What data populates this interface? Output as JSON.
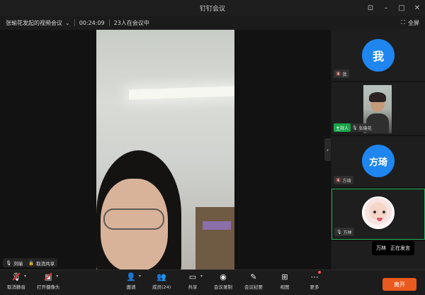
{
  "window": {
    "title": "钉钉会议"
  },
  "info": {
    "meeting_name": "张瑜花发起的视频会议",
    "duration": "00:24:09",
    "participants_status": "23人在会议中"
  },
  "fullscreen_label": "全屏",
  "main_video": {
    "speaker_label": "刘瑜",
    "screen_share_label": "取消共享"
  },
  "participants": [
    {
      "avatar_text": "我",
      "name": "我",
      "avatar_color": "#1f86f0"
    },
    {
      "badge": "主持人",
      "name": "张瑜花"
    },
    {
      "avatar_text": "方琦",
      "name": "方琦",
      "avatar_color": "#1f86f0"
    },
    {
      "name": "万林"
    }
  ],
  "tooltip": {
    "name": "万林",
    "status": "正在发言"
  },
  "toolbar": {
    "mute": "取消静音",
    "camera": "打开摄像头",
    "invite": "邀请",
    "members": "成员(24)",
    "share": "共享",
    "record": "会议录制",
    "minutes": "会议纪要",
    "view": "视图",
    "more": "更多",
    "leave": "离开"
  },
  "colors": {
    "accent": "#1f86f0",
    "host": "#1aa34a",
    "leave": "#ea5a1e",
    "active_border": "#1fb25a"
  }
}
